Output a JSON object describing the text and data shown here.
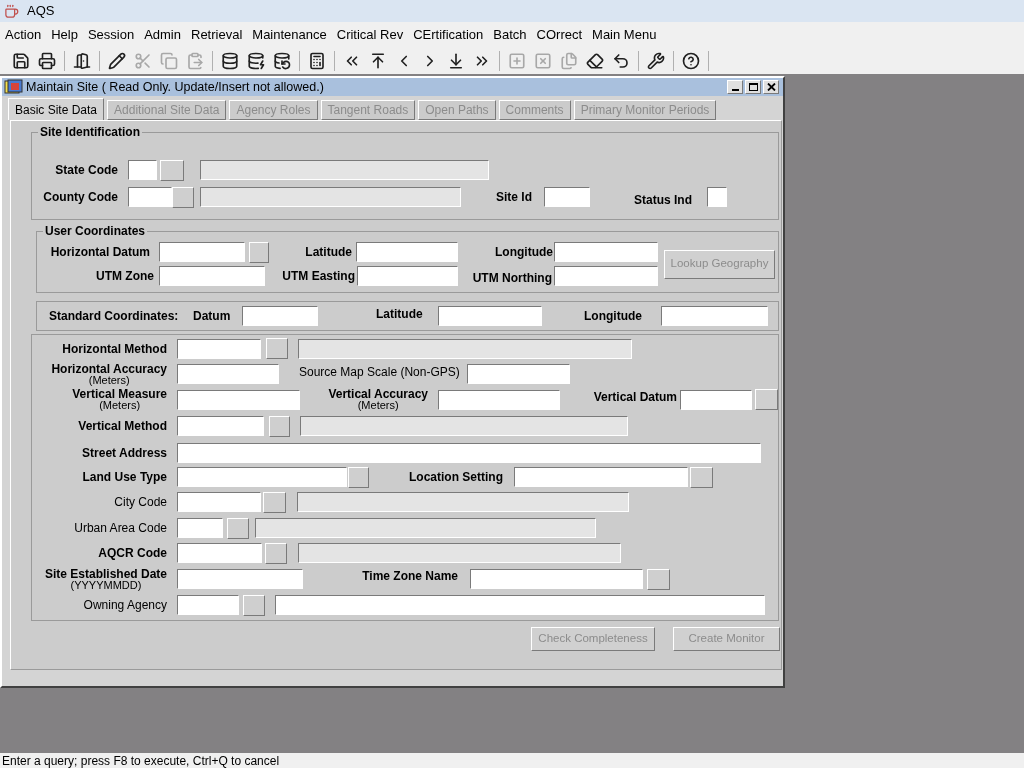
{
  "app": {
    "title": "AQS"
  },
  "menu": [
    "Action",
    "Help",
    "Session",
    "Admin",
    "Retrieval",
    "Maintenance",
    "Critical Rev",
    "CErtification",
    "Batch",
    "COrrect",
    "Main Menu"
  ],
  "toolbar_groups": [
    [
      {
        "kind": "save",
        "disabled": false
      },
      {
        "kind": "print",
        "disabled": false
      }
    ],
    [
      {
        "kind": "exit",
        "disabled": false
      }
    ],
    [
      {
        "kind": "edit",
        "disabled": false
      },
      {
        "kind": "cut",
        "disabled": true
      },
      {
        "kind": "copy",
        "disabled": true
      },
      {
        "kind": "paste",
        "disabled": true
      }
    ],
    [
      {
        "kind": "enter_query",
        "disabled": false
      },
      {
        "kind": "execute_query",
        "disabled": false
      },
      {
        "kind": "cancel_query",
        "disabled": false
      }
    ],
    [
      {
        "kind": "calculator",
        "disabled": false
      }
    ],
    [
      {
        "kind": "first",
        "disabled": false
      },
      {
        "kind": "top",
        "disabled": false
      },
      {
        "kind": "previous",
        "disabled": false
      },
      {
        "kind": "next",
        "disabled": false
      },
      {
        "kind": "down",
        "disabled": false
      },
      {
        "kind": "last",
        "disabled": false
      }
    ],
    [
      {
        "kind": "insert",
        "disabled": true
      },
      {
        "kind": "delete",
        "disabled": true
      },
      {
        "kind": "duplicate",
        "disabled": true
      },
      {
        "kind": "clear",
        "disabled": false
      },
      {
        "kind": "undo",
        "disabled": false
      }
    ],
    [
      {
        "kind": "tool",
        "disabled": false
      }
    ],
    [
      {
        "kind": "help",
        "disabled": false
      }
    ]
  ],
  "window": {
    "title": "Maintain Site ( Read Only. Update/Insert not allowed.)"
  },
  "tabs": [
    {
      "label": "Basic Site Data",
      "selected": true,
      "disabled": false
    },
    {
      "label": "Additional Site Data",
      "selected": false,
      "disabled": true
    },
    {
      "label": "Agency Roles",
      "selected": false,
      "disabled": true
    },
    {
      "label": "Tangent Roads",
      "selected": false,
      "disabled": true
    },
    {
      "label": "Open Paths",
      "selected": false,
      "disabled": true
    },
    {
      "label": "Comments",
      "selected": false,
      "disabled": true
    },
    {
      "label": "Primary Monitor Periods",
      "selected": false,
      "disabled": true
    }
  ],
  "sections": [
    {
      "title": "Site Identification",
      "fields": [
        {
          "label": "State Code",
          "required": true,
          "lookup": true,
          "description": {
            "disabled": true
          }
        },
        {
          "label": "County Code",
          "required": true,
          "lookup": true,
          "description": {
            "disabled": true
          }
        },
        {
          "label": "Site Id",
          "required": true,
          "lookup": false
        },
        {
          "label": "Status Ind",
          "required": true,
          "lookup": false
        }
      ]
    },
    {
      "title": "User Coordinates",
      "fields": [
        {
          "label": "Horizontal Datum",
          "required": true,
          "lookup": true
        },
        {
          "label": "Latitude",
          "required": true,
          "lookup": false
        },
        {
          "label": "Longitude",
          "required": true,
          "lookup": false
        },
        {
          "label": "UTM Zone",
          "required": true,
          "lookup": false
        },
        {
          "label": "UTM Easting",
          "required": true,
          "lookup": false
        },
        {
          "label": "UTM Northing",
          "required": true,
          "lookup": false
        }
      ],
      "button": {
        "label": "Lookup Geography",
        "disabled": true
      }
    },
    {
      "title": "Standard Coordinates:",
      "fields": [
        {
          "label": "Datum",
          "required": true,
          "lookup": false
        },
        {
          "label": "Latitude",
          "required": true,
          "lookup": false
        },
        {
          "label": "Longitude",
          "required": true,
          "lookup": false
        }
      ]
    },
    {
      "fields": [
        {
          "label": "Horizontal Method",
          "required": true,
          "lookup": true,
          "description": {
            "disabled": true
          }
        },
        {
          "label": "Horizontal Accuracy",
          "note": "(Meters)",
          "required": true,
          "lookup": false
        },
        {
          "label": "Source Map Scale (Non-GPS)",
          "required": false,
          "lookup": false
        },
        {
          "label": "Vertical Measure",
          "note": "(Meters)",
          "required": true,
          "lookup": false
        },
        {
          "label": "Vertical Accuracy",
          "note": "(Meters)",
          "required": true,
          "lookup": false
        },
        {
          "label": "Vertical Datum",
          "required": true,
          "lookup": true
        },
        {
          "label": "Vertical Method",
          "required": true,
          "lookup": true,
          "description": {
            "disabled": true
          }
        },
        {
          "label": "Street Address",
          "required": true,
          "lookup": false
        },
        {
          "label": "Land Use Type",
          "required": true,
          "lookup": true
        },
        {
          "label": "Location Setting",
          "required": true,
          "lookup": true
        },
        {
          "label": "City Code",
          "required": false,
          "lookup": true,
          "description": {
            "disabled": true
          }
        },
        {
          "label": "Urban Area Code",
          "required": false,
          "lookup": true,
          "description": {
            "disabled": true
          }
        },
        {
          "label": "AQCR Code",
          "required": true,
          "lookup": true,
          "description": {
            "disabled": true
          }
        },
        {
          "label": "Site Established Date",
          "note": "(YYYYMMDD)",
          "required": true,
          "lookup": false
        },
        {
          "label": "Time Zone Name",
          "required": true,
          "lookup": true
        },
        {
          "label": "Owning Agency",
          "required": false,
          "lookup": true,
          "description": {
            "disabled": false
          }
        }
      ]
    }
  ],
  "buttons": [
    {
      "label": "Check Completeness",
      "disabled": true
    },
    {
      "label": "Create Monitor",
      "disabled": true
    }
  ],
  "status_bar": "Enter a query; press F8 to execute, Ctrl+Q to cancel"
}
